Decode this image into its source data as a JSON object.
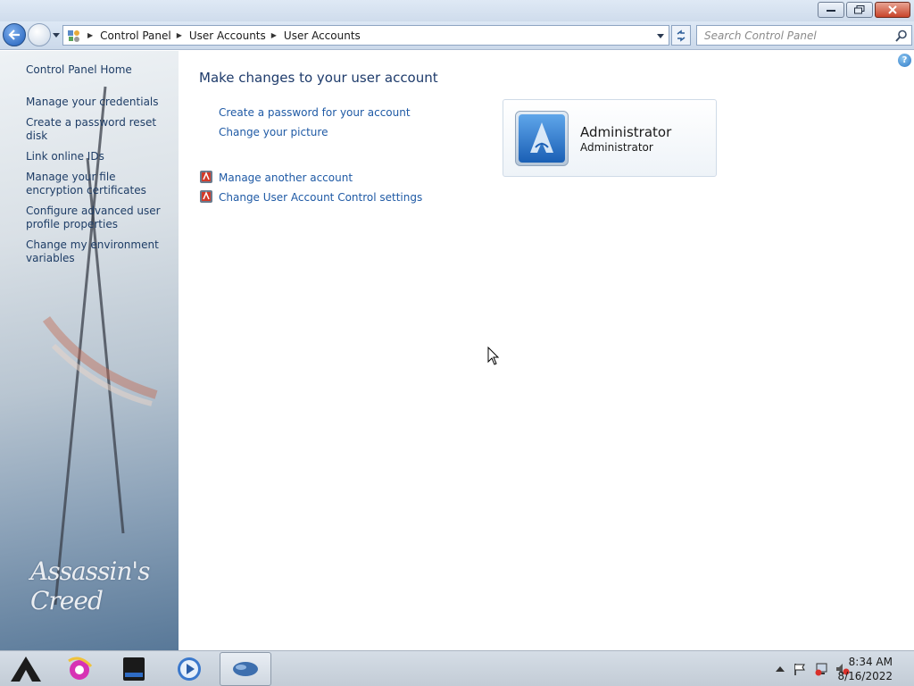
{
  "window": {
    "controls": {
      "minimize": "minimize",
      "maximize": "restore",
      "close": "close"
    }
  },
  "toolbar": {
    "breadcrumb": [
      "Control Panel",
      "User Accounts",
      "User Accounts"
    ],
    "search_placeholder": "Search Control Panel"
  },
  "sidebar": {
    "home": "Control Panel Home",
    "links": [
      "Manage your credentials",
      "Create a password reset disk",
      "Link online IDs",
      "Manage your file encryption certificates",
      "Configure advanced user profile properties",
      "Change my environment variables"
    ],
    "brand_text": "Assassin's Creed"
  },
  "main": {
    "title": "Make changes to your user account",
    "tasks": [
      "Create a password for your account",
      "Change your picture"
    ],
    "shield_tasks": [
      "Manage another account",
      "Change User Account Control settings"
    ],
    "account": {
      "name": "Administrator",
      "type": "Administrator"
    }
  },
  "taskbar": {
    "pinned": [
      "start-icon",
      "internet-explorer-icon",
      "file-explorer-icon",
      "media-player-icon",
      "control-panel-icon"
    ],
    "clock": {
      "time": "8:34 AM",
      "date": "8/16/2022"
    }
  },
  "colors": {
    "link": "#1f5aa5",
    "title": "#1e3b6b",
    "sidebar_link": "#1e3d66"
  }
}
